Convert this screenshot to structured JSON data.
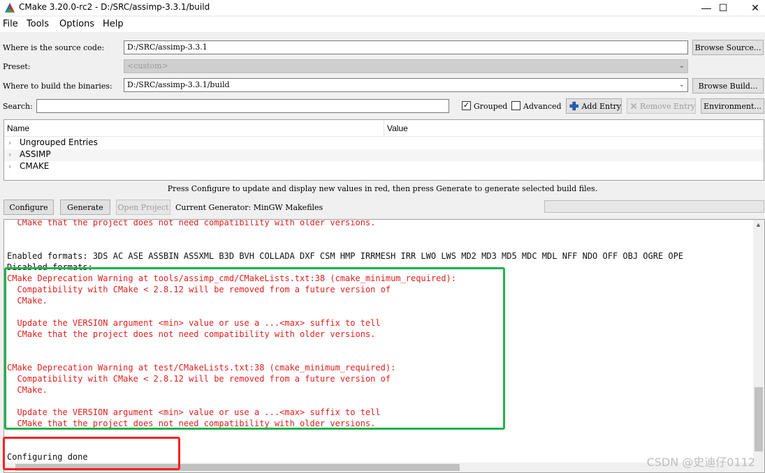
{
  "window": {
    "title": "CMake 3.20.0-rc2 - D:/SRC/assimp-3.3.1/build",
    "minimize_glyph": "—",
    "maximize_glyph": "☐",
    "close_glyph": "✕",
    "icon": "cmake-triangle-icon"
  },
  "menu": [
    "File",
    "Tools",
    "Options",
    "Help"
  ],
  "form": {
    "source_label": "Where is the source code:",
    "source_value": "D:/SRC/assimp-3.3.1",
    "browse_source": "Browse Source...",
    "preset_label": "Preset:",
    "preset_value": "<custom>",
    "build_label": "Where to build the binaries:",
    "build_value": "D:/SRC/assimp-3.3.1/build",
    "browse_build": "Browse Build...",
    "search_label": "Search:",
    "search_value": "",
    "grouped_label": "Grouped",
    "grouped_checked": "✓",
    "advanced_label": "Advanced",
    "add_entry": "Add Entry",
    "remove_entry": "Remove Entry",
    "environment": "Environment..."
  },
  "tree": {
    "col_name": "Name",
    "col_value": "Value",
    "rows": [
      "Ungrouped Entries",
      "ASSIMP",
      "CMAKE"
    ]
  },
  "hint": "Press Configure to update and display new values in red, then press Generate to generate selected build files.",
  "actions": {
    "configure": "Configure",
    "generate": "Generate",
    "open_project": "Open Project",
    "current_generator": "Current Generator: MinGW Makefiles"
  },
  "output": {
    "lines": [
      "  CMake that the project does not need compatibility with older versions.",
      "",
      "",
      "Enabled formats: 3DS AC ASE ASSBIN ASSXML B3D BVH COLLADA DXF CSM HMP IRRMESH IRR LWO LWS MD2 MD3 MD5 MDC MDL NFF NDO OFF OBJ OGRE OPE",
      "Disabled formats:",
      "CMake Deprecation Warning at tools/assimp_cmd/CMakeLists.txt:38 (cmake_minimum_required):",
      "  Compatibility with CMake < 2.8.12 will be removed from a future version of",
      "  CMake.",
      "",
      "  Update the VERSION argument <min> value or use a ...<max> suffix to tell",
      "  CMake that the project does not need compatibility with older versions.",
      "",
      "",
      "CMake Deprecation Warning at test/CMakeLists.txt:38 (cmake_minimum_required):",
      "  Compatibility with CMake < 2.8.12 will be removed from a future version of",
      "  CMake.",
      "",
      "  Update the VERSION argument <min> value or use a ...<max> suffix to tell",
      "  CMake that the project does not need compatibility with older versions.",
      "",
      "",
      "Configuring done"
    ],
    "colors": [
      "red",
      "",
      "",
      "black",
      "black",
      "red",
      "red",
      "red",
      "",
      "red",
      "red",
      "",
      "",
      "red",
      "red",
      "red",
      "",
      "red",
      "red",
      "",
      "",
      "black"
    ]
  },
  "watermark": "CSDN @史迪仔0112",
  "colors": {
    "error_red": "#e0201e",
    "highlight_green": "#22b14c",
    "highlight_red": "#ff2020"
  }
}
